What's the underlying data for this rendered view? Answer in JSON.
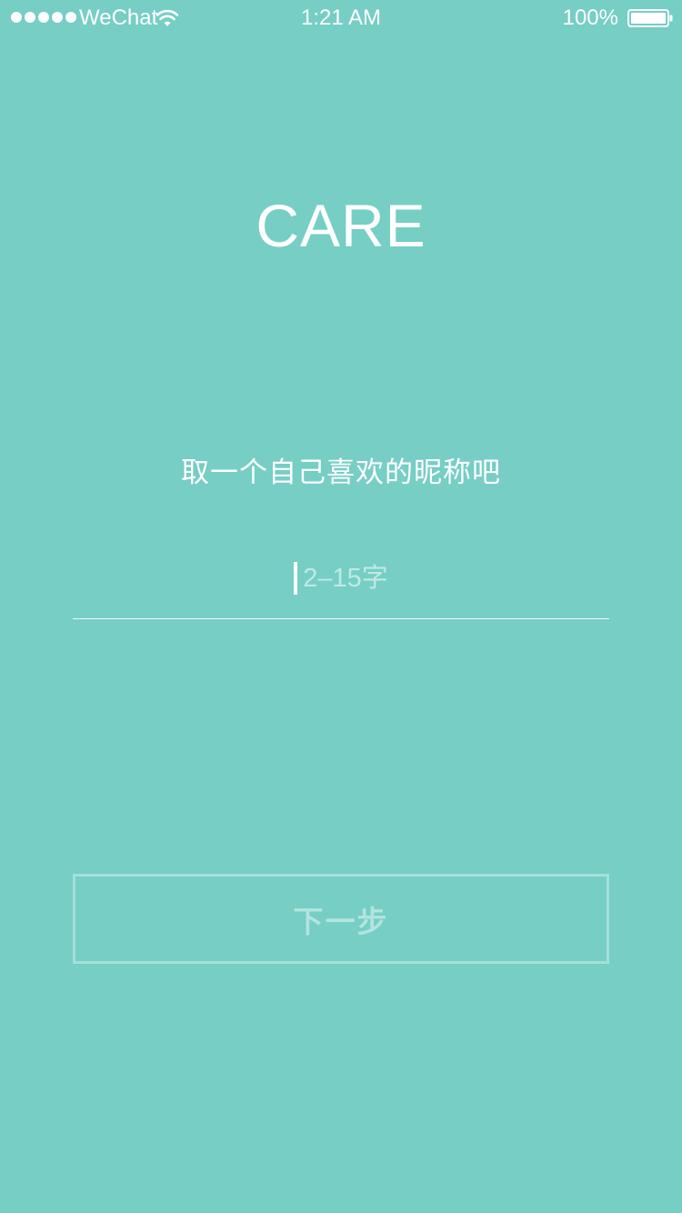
{
  "status_bar": {
    "carrier": "WeChat",
    "time": "1:21 AM",
    "battery_percent": "100%",
    "signal_bars": 5
  },
  "app": {
    "title": "CARE"
  },
  "form": {
    "prompt": "取一个自己喜欢的昵称吧",
    "nickname_placeholder": "2–15字",
    "nickname_value": ""
  },
  "actions": {
    "next_label": "下一步"
  },
  "colors": {
    "background": "#76cec5",
    "foreground": "#ffffff"
  }
}
